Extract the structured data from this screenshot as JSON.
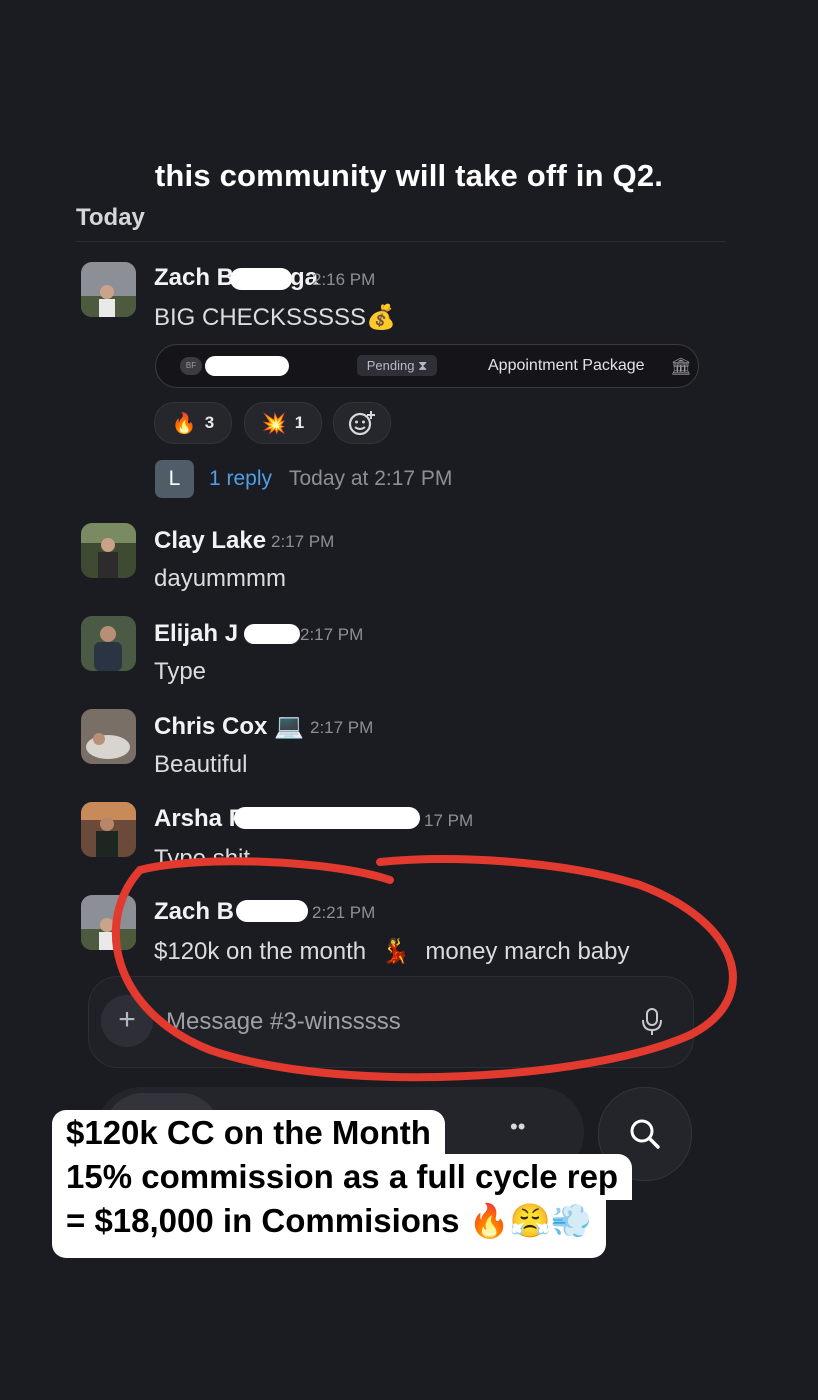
{
  "caption": "this community will take off in Q2.",
  "day_label": "Today",
  "messages": [
    {
      "author": "Zach B",
      "author_tail": "ga",
      "time": "2:16 PM",
      "text": "BIG CHECKSSSSS",
      "text_emoji": "💰",
      "card": {
        "avatar_initials": "BF",
        "status": "Pending",
        "status_icon": "hourglass-icon",
        "title": "Appointment Package",
        "trailing_icon": "bank-icon"
      },
      "reactions": [
        {
          "emoji": "🔥",
          "count": "3"
        },
        {
          "emoji": "💥",
          "count": "1"
        }
      ],
      "thread": {
        "avatar_letter": "L",
        "link": "1 reply",
        "time": "Today at 2:17 PM"
      }
    },
    {
      "author": "Clay Lake",
      "time": "2:17 PM",
      "text": "dayummmm"
    },
    {
      "author": "Elijah J",
      "time": "2:17 PM",
      "text": "Type"
    },
    {
      "author": "Chris Cox",
      "author_emoji": "💻",
      "time": "2:17 PM",
      "text": "Beautiful"
    },
    {
      "author": "Arsha P",
      "time": "17 PM",
      "text": "Type shit"
    },
    {
      "author": "Zach B",
      "time": "2:21 PM",
      "text": "$120k on the month",
      "text_emoji": "💃",
      "text_tail": "money march baby"
    }
  ],
  "composer": {
    "placeholder": "Message #3-winsssss",
    "plus": "+",
    "mic_icon": "microphone-icon"
  },
  "tabbar": {
    "search_icon": "search-icon"
  },
  "overlay": {
    "line1": "$120k CC on the Month",
    "line2": "15% commission as a full cycle rep",
    "line3": "= $18,000 in Commisions",
    "line3_emojis": "🔥😤💨"
  },
  "annotation_color": "#e23a2e"
}
